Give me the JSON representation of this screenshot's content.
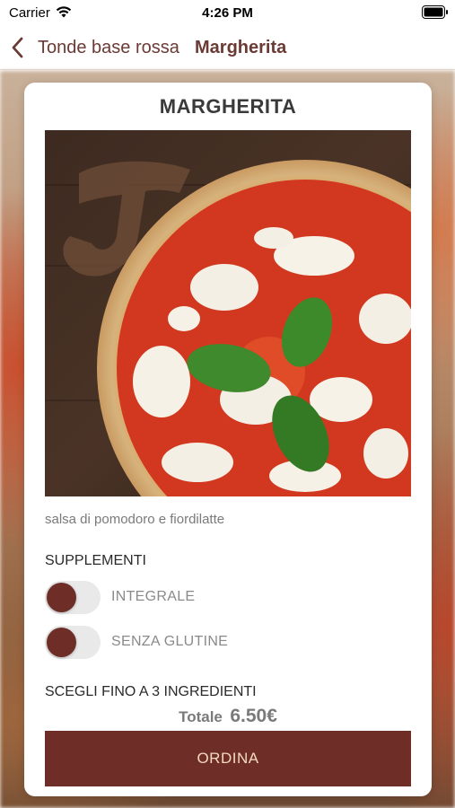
{
  "status_bar": {
    "carrier": "Carrier",
    "time": "4:26 PM",
    "icons": [
      "wifi-icon",
      "battery-icon"
    ]
  },
  "nav": {
    "back_label": "Tonde base rossa",
    "title": "Margherita",
    "back_icon": "chevron-left-icon"
  },
  "product": {
    "name": "MARGHERITA",
    "description": "salsa di pomodoro e fiordilatte"
  },
  "supplements": {
    "header": "SUPPLEMENTI",
    "items": [
      {
        "label": "INTEGRALE",
        "enabled": false
      },
      {
        "label": "SENZA GLUTINE",
        "enabled": false
      }
    ]
  },
  "ingredients": {
    "header": "SCEGLI FINO A 3 INGREDIENTI"
  },
  "total": {
    "label": "Totale",
    "value": "6.50€"
  },
  "order_button": {
    "label": "ORDINA"
  },
  "colors": {
    "brand": "#6e2d26",
    "nav_text": "#6b3a34",
    "button_text": "#f2d9c0",
    "toggle_track": "#e9e9ea"
  }
}
